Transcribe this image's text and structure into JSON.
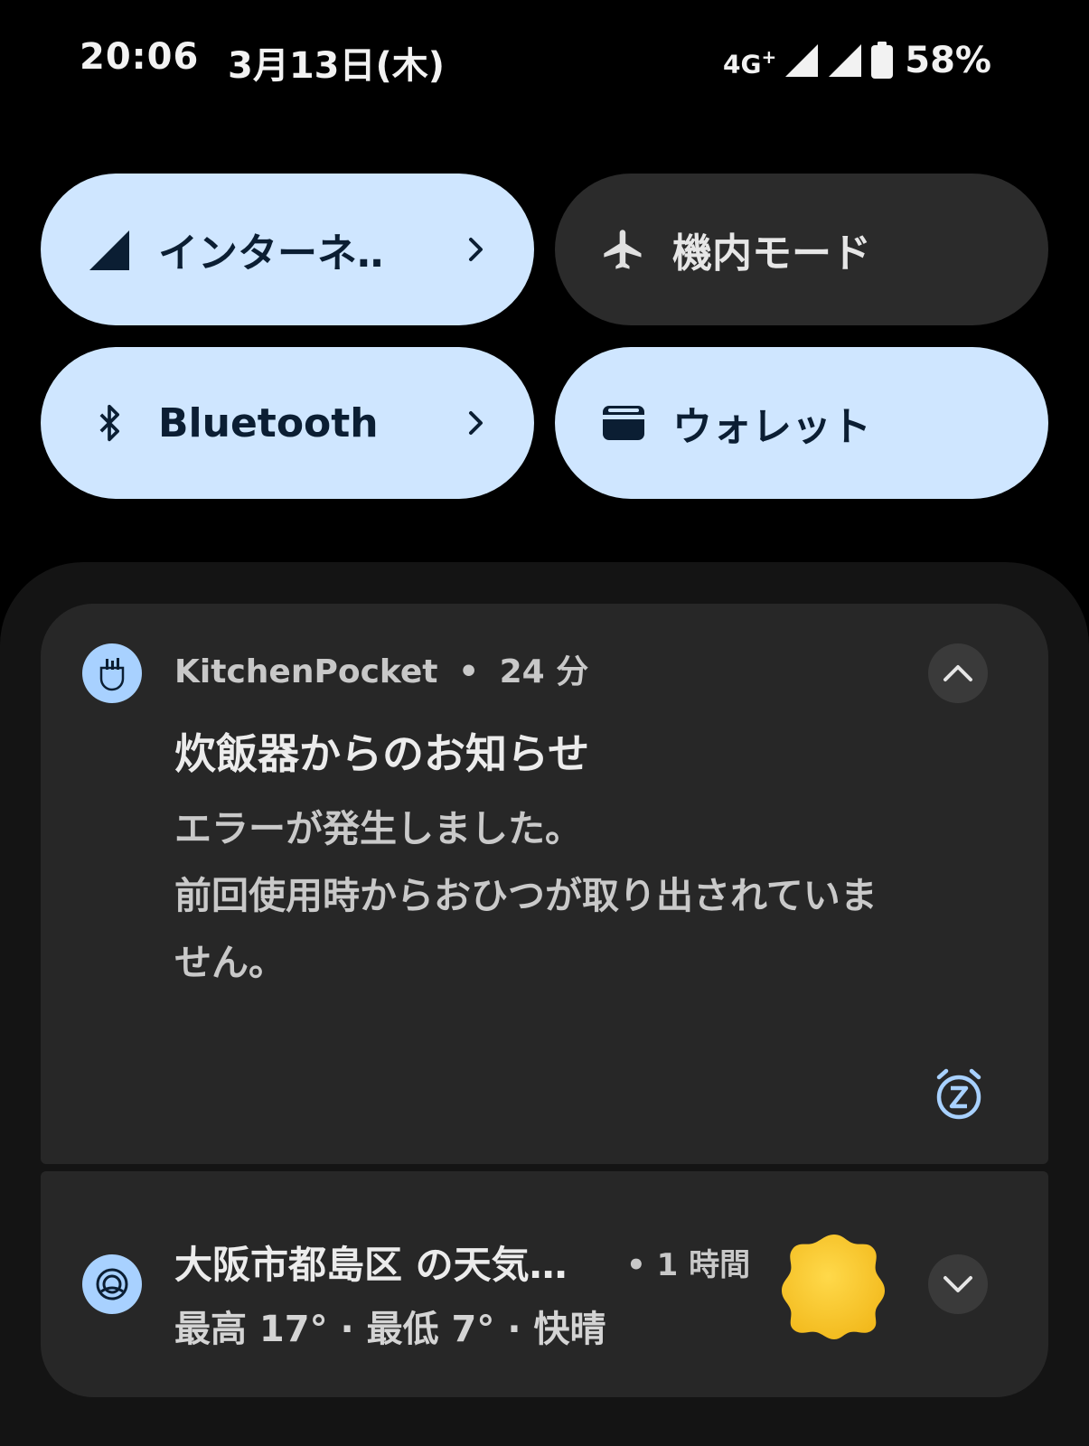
{
  "status_bar": {
    "time": "20:06",
    "date": "3月13日(木)",
    "network": "4G",
    "network_plus": "+",
    "battery": "58%"
  },
  "quick_tiles": [
    {
      "label": "インターネ‥",
      "icon": "signal-icon",
      "state": "on",
      "has_chevron": true
    },
    {
      "label": "機内モード",
      "icon": "airplane-icon",
      "state": "off",
      "has_chevron": false
    },
    {
      "label": "Bluetooth",
      "icon": "bluetooth-icon",
      "state": "on",
      "has_chevron": true
    },
    {
      "label": "ウォレット",
      "icon": "wallet-icon",
      "state": "on",
      "has_chevron": false
    }
  ],
  "notifications": [
    {
      "app": "KitchenPocket",
      "time": "24 分",
      "separator": "•",
      "title": "炊飯器からのお知らせ",
      "body_line1": "エラーが発生しました。",
      "body_line2": "前回使用時からおひつが取り出されていま",
      "body_line3": "せん。",
      "expanded": true
    },
    {
      "title": "大阪市都島区 の天気…",
      "time": "1 時間",
      "separator": "•",
      "summary": "最高 17° · 最低 7° · 快晴",
      "expanded": false
    }
  ],
  "colors": {
    "tile_on": "#cfe6ff",
    "tile_off": "#2b2b2b",
    "accent_icon": "#a8d1ff",
    "sun": "#f7c52a"
  }
}
